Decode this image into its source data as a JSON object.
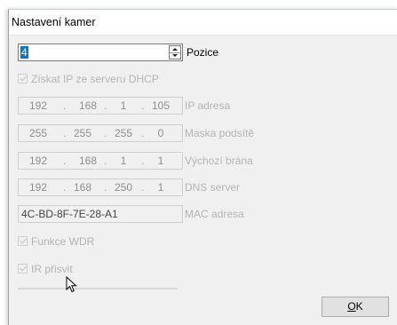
{
  "window": {
    "title": "Nastavení kamer"
  },
  "position": {
    "value": "4",
    "label": "Pozice"
  },
  "dhcp": {
    "label": "Získat IP ze serveru DHCP",
    "checked": true
  },
  "ip_address": {
    "octets": [
      "192",
      "168",
      "1",
      "105"
    ],
    "label": "IP adresa"
  },
  "subnet_mask": {
    "octets": [
      "255",
      "255",
      "255",
      "0"
    ],
    "label": "Maska podsítě"
  },
  "gateway": {
    "octets": [
      "192",
      "168",
      "1",
      "1"
    ],
    "label": "Výchozí brána"
  },
  "dns": {
    "octets": [
      "192",
      "168",
      "250",
      "1"
    ],
    "label": "DNS server"
  },
  "mac": {
    "value": "4C-BD-8F-7E-28-A1",
    "label": "MAC adresa"
  },
  "wdr": {
    "label": "Funkce WDR",
    "checked": true
  },
  "ir": {
    "label": "IR přisvit",
    "checked": true
  },
  "buttons": {
    "ok_mnemonic": "O",
    "ok_rest": "K"
  },
  "icons": {
    "spin_up": "triangle-up-icon",
    "spin_down": "triangle-down-icon",
    "cursor": "arrow-cursor-icon"
  },
  "colors": {
    "selection": "#0078d7",
    "disabled_text": "#b4b4b4",
    "dialog_bg": "#f0f0f0"
  }
}
